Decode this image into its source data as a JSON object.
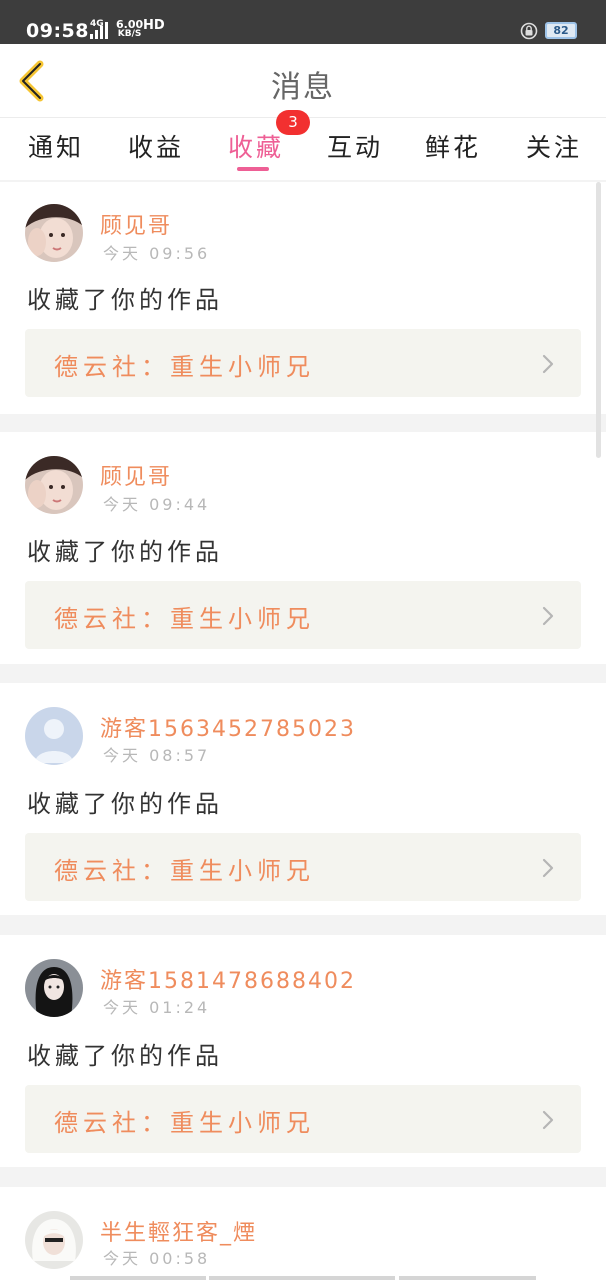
{
  "status_bar": {
    "time": "09:58",
    "network_type": "4G",
    "speed_value": "6.00",
    "speed_unit": "KB/S",
    "hd_label": "HD",
    "battery_level": "82"
  },
  "header": {
    "title": "消息"
  },
  "tabs": [
    {
      "label": "通知",
      "active": false
    },
    {
      "label": "收益",
      "active": false
    },
    {
      "label": "收藏",
      "active": true,
      "badge": "3"
    },
    {
      "label": "互动",
      "active": false
    },
    {
      "label": "鲜花",
      "active": false
    },
    {
      "label": "关注",
      "active": false
    }
  ],
  "accent_color": "#ee5f95",
  "name_color": "#ef8c5d",
  "messages": [
    {
      "username": "顾见哥",
      "time": "今天 09:56",
      "action": "收藏了你的作品",
      "work_title": "德云社：重生小师兄",
      "avatar": "girl-photo-avatar"
    },
    {
      "username": "顾见哥",
      "time": "今天 09:44",
      "action": "收藏了你的作品",
      "work_title": "德云社：重生小师兄",
      "avatar": "girl-photo-avatar"
    },
    {
      "username": "游客1563452785023",
      "time": "今天 08:57",
      "action": "收藏了你的作品",
      "work_title": "德云社：重生小师兄",
      "avatar": "default-user-avatar"
    },
    {
      "username": "游客1581478688402",
      "time": "今天 01:24",
      "action": "收藏了你的作品",
      "work_title": "德云社：重生小师兄",
      "avatar": "dark-hair-girl-avatar"
    },
    {
      "username": "半生輕狂客_煙",
      "time": "今天 00:58",
      "avatar": "white-hair-avatar"
    }
  ]
}
